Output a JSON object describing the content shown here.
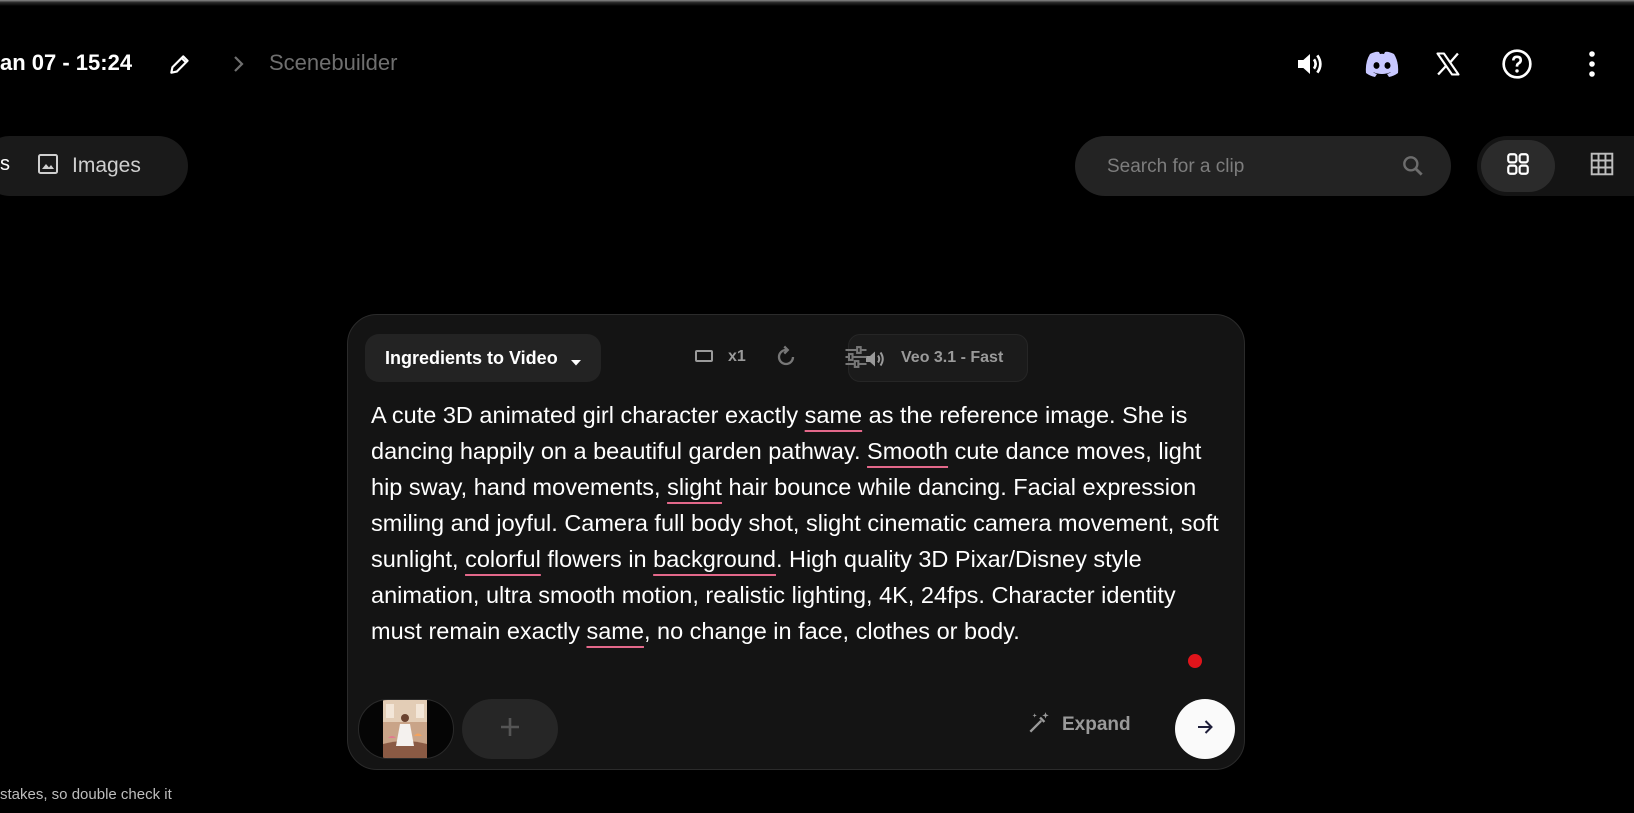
{
  "header": {
    "project_title": "an 07 - 15:24",
    "breadcrumb_current": "Scenebuilder",
    "icons": [
      "volume-icon",
      "discord-icon",
      "x-logo-icon",
      "help-icon",
      "more-vert-icon"
    ]
  },
  "tabs": {
    "prev_label_fragment": "s",
    "images_label": "Images"
  },
  "search": {
    "placeholder": "Search for a clip"
  },
  "composer": {
    "mode_label": "Ingredients to Video",
    "model_label": "Veo 3.1 - Fast",
    "output_count": "x1",
    "prompt_parts": [
      {
        "t": "A cute 3D animated girl character exactly "
      },
      {
        "t": "same",
        "u": true
      },
      {
        "t": " as the reference image. She is dancing happily on a beautiful garden pathway. "
      },
      {
        "t": "Smooth",
        "u": true
      },
      {
        "t": " cute dance moves, light hip sway, hand movements, "
      },
      {
        "t": "slight",
        "u": true
      },
      {
        "t": " hair bounce while dancing. Facial expression smiling and joyful. Camera full body shot, slight cinematic camera movement, soft sunlight, "
      },
      {
        "t": "colorful",
        "u": true
      },
      {
        "t": " flowers in "
      },
      {
        "t": "background",
        "u": true
      },
      {
        "t": ". High quality 3D Pixar/Disney style animation, ultra smooth motion, realistic lighting, 4K, 24fps. Character identity must remain exactly "
      },
      {
        "t": "same",
        "u": true
      },
      {
        "t": ", no change in face, clothes or body."
      }
    ],
    "expand_label": "Expand"
  },
  "footer": {
    "disclaimer": "stakes, so double check it"
  },
  "colors": {
    "background": "#000000",
    "panel": "#141414",
    "underline": "#e3688a",
    "record_dot": "#e0141b",
    "discord": "#c8c8ff"
  }
}
